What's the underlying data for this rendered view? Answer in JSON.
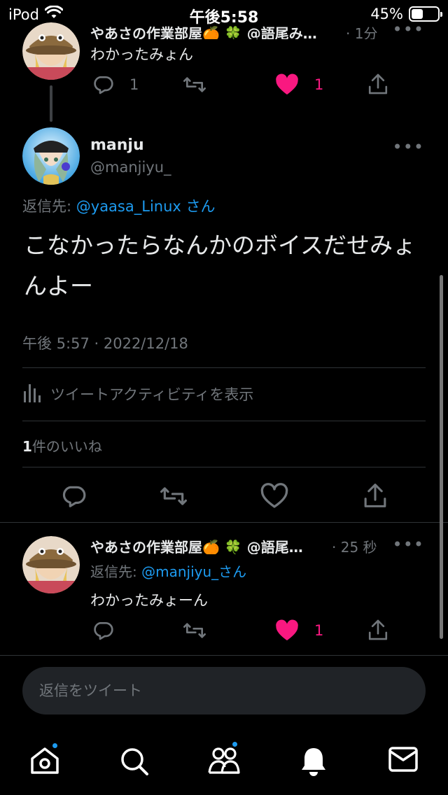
{
  "status_bar": {
    "carrier": "iPod",
    "time": "午後5:58",
    "battery": "45%",
    "battery_level": 0.45
  },
  "prev_tweet": {
    "name": "やあさの作業部屋🍊 🍀 @語尾み…",
    "time_suffix": "· 1分",
    "text": "わかったみょん",
    "reply_count": "1",
    "like_count": "1"
  },
  "main_tweet": {
    "name": "manju",
    "handle": "@manjiyu_",
    "reply_to_prefix": "返信先: ",
    "reply_to_user": "@yaasa_Linux",
    "reply_to_suffix": " さん",
    "text": "こなかったらなんかのボイスだせみょんよー",
    "timestamp": "午後 5:57 · 2022/12/18",
    "activity_label": "ツイートアクティビティを表示",
    "likes_count": "1",
    "likes_label": "件のいいね"
  },
  "reply_tweet": {
    "name": "やあさの作業部屋🍊 🍀 @語尾…",
    "time_suffix": "· 25 秒",
    "reply_to_prefix": "返信先: ",
    "reply_to_user": "@manjiyu_",
    "reply_to_suffix": "さん",
    "text": "わかったみょーん",
    "like_count": "1"
  },
  "compose": {
    "placeholder": "返信をツイート"
  },
  "colors": {
    "accent": "#1d9bf0",
    "like": "#f91880",
    "muted": "#71767b"
  },
  "icons": [
    "wifi-icon",
    "reply-icon",
    "retweet-icon",
    "heart-icon",
    "share-icon",
    "analytics-icon",
    "home-icon",
    "search-icon",
    "communities-icon",
    "notifications-icon",
    "messages-icon"
  ]
}
